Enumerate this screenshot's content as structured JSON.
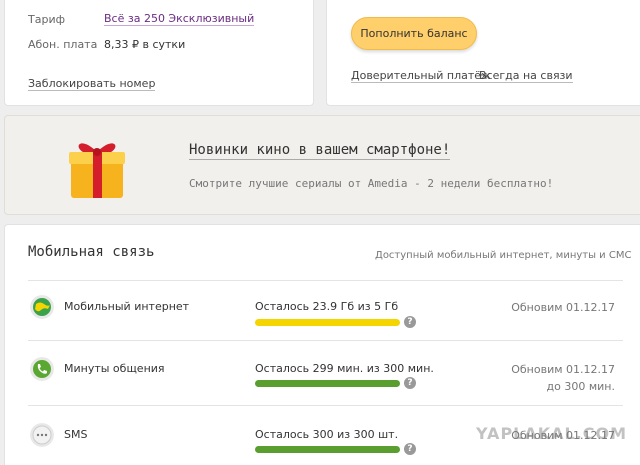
{
  "tariff_card": {
    "tariff_label": "Тариф",
    "tariff_value": "Всё за 250 Эксклюзивный",
    "fee_label": "Абон. плата",
    "fee_value": "8,33 ₽ в сутки",
    "block_link": "Заблокировать номер"
  },
  "balance_card": {
    "topup_button": "Пополнить баланс",
    "trust_payment_link": "Доверительный платёж",
    "always_connected_link": "Всегда на связи"
  },
  "promo": {
    "title": "Новинки кино в вашем смартфоне!",
    "subtitle": "Смотрите лучшие сериалы от Amedia - 2 недели бесплатно!",
    "icon": "gift-icon"
  },
  "mobile": {
    "title": "Мобильная связь",
    "subtitle": "Доступный мобильный интернет, минуты и СМС",
    "services": [
      {
        "name": "Мобильный интернет",
        "remaining": "Осталось 23.9 Гб из 5 Гб",
        "bar_color": "#f5d500",
        "icon": "globe-icon",
        "update": "Обновим 01.12.17",
        "limit": ""
      },
      {
        "name": "Минуты общения",
        "remaining": "Осталось 299 мин. из 300 мин.",
        "bar_color": "#5a9e2f",
        "icon": "phone-icon",
        "update": "Обновим 01.12.17",
        "limit": "до 300 мин."
      },
      {
        "name": "SMS",
        "remaining": "Осталось 300 из 300 шт.",
        "bar_color": "#5a9e2f",
        "icon": "sms-icon",
        "update": "Обновим 01.12.17",
        "limit": ""
      }
    ],
    "help_glyph": "?"
  },
  "watermark": "YAPLAKAL.COM"
}
